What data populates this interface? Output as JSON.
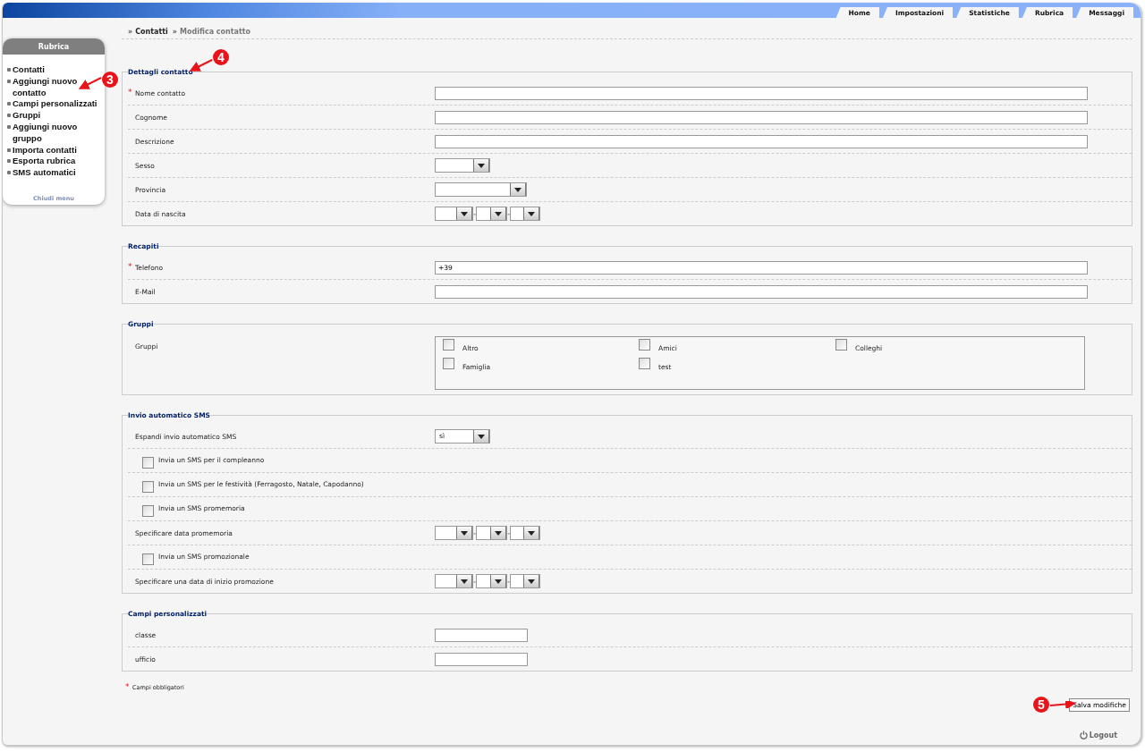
{
  "header_tabs": [
    {
      "label": "Home"
    },
    {
      "label": "Impostazioni"
    },
    {
      "label": "Statistiche"
    },
    {
      "label": "Rubrica"
    },
    {
      "label": "Messaggi"
    }
  ],
  "sidebar": {
    "title": "Rubrica",
    "items": [
      {
        "label": "Contatti"
      },
      {
        "label": "Aggiungi nuovo contatto",
        "callout": "3"
      },
      {
        "label": "Campi personalizzati"
      },
      {
        "label": "Gruppi"
      },
      {
        "label": "Aggiungi nuovo gruppo"
      },
      {
        "label": "Importa contatti"
      },
      {
        "label": "Esporta rubrica"
      },
      {
        "label": "SMS automatici"
      }
    ],
    "footer_link": "Chiudi menu"
  },
  "breadcrumb": {
    "separator": "»",
    "items": [
      "Contatti",
      "Modifica contatto"
    ]
  },
  "required_mark": "*",
  "sections": [
    {
      "legend": "Dettagli contatto",
      "callout": "4",
      "rows": [
        {
          "kind": "text",
          "label": "Nome contatto",
          "required": true,
          "wide": true
        },
        {
          "kind": "text",
          "label": "Cognome",
          "required": false,
          "wide": true
        },
        {
          "kind": "text",
          "label": "Descrizione",
          "required": false,
          "wide": true
        },
        {
          "kind": "select",
          "label": "Sesso",
          "required": false,
          "wide": false
        },
        {
          "kind": "select",
          "label": "Provincia",
          "required": false,
          "wide": true
        },
        {
          "kind": "date",
          "label": "Data di nascita",
          "required": false,
          "separator": "-"
        }
      ]
    },
    {
      "legend": "Recapiti",
      "rows": [
        {
          "kind": "text",
          "label": "Telefono",
          "required": true,
          "wide": true,
          "value": "+39"
        },
        {
          "kind": "text",
          "label": "E-Mail",
          "required": false,
          "wide": true
        }
      ]
    },
    {
      "legend": "Gruppi",
      "rows": [
        {
          "kind": "checkgroup",
          "label": "Gruppi",
          "required": false,
          "options": [
            {
              "label": "Altro",
              "checked": false
            },
            {
              "label": "Amici",
              "checked": false
            },
            {
              "label": "Colleghi",
              "checked": false
            },
            {
              "label": "Famiglia",
              "checked": false
            },
            {
              "label": "test",
              "checked": false
            }
          ]
        }
      ]
    },
    {
      "legend": "Invio automatico SMS",
      "rows": [
        {
          "kind": "select",
          "label": "Espandi invio automatico SMS",
          "required": false,
          "wide": false,
          "value": "sì"
        },
        {
          "kind": "checkbox",
          "label": "Invia un SMS per il compleanno",
          "checked": false
        },
        {
          "kind": "checkbox",
          "label": "Invia un SMS per le festività (Ferragosto, Natale, Capodanno)",
          "checked": false
        },
        {
          "kind": "checkbox",
          "label": "Invia un SMS promemoria",
          "checked": false
        },
        {
          "kind": "date",
          "label": "Specificare data promemoria",
          "required": false,
          "separator": "-"
        },
        {
          "kind": "checkbox",
          "label": "Invia un SMS promozionale",
          "checked": false
        },
        {
          "kind": "date",
          "label": "Specificare una data di inizio promozione",
          "required": false,
          "separator": "-"
        }
      ]
    },
    {
      "legend": "Campi personalizzati",
      "rows": [
        {
          "kind": "text",
          "label": "classe",
          "required": false,
          "wide": false
        },
        {
          "kind": "text",
          "label": "ufficio",
          "required": false,
          "wide": false
        }
      ]
    }
  ],
  "required_note": "Campi obbligatori",
  "save_button": {
    "label": "Salva modifiche",
    "callout": "5"
  },
  "logout": "Logout"
}
